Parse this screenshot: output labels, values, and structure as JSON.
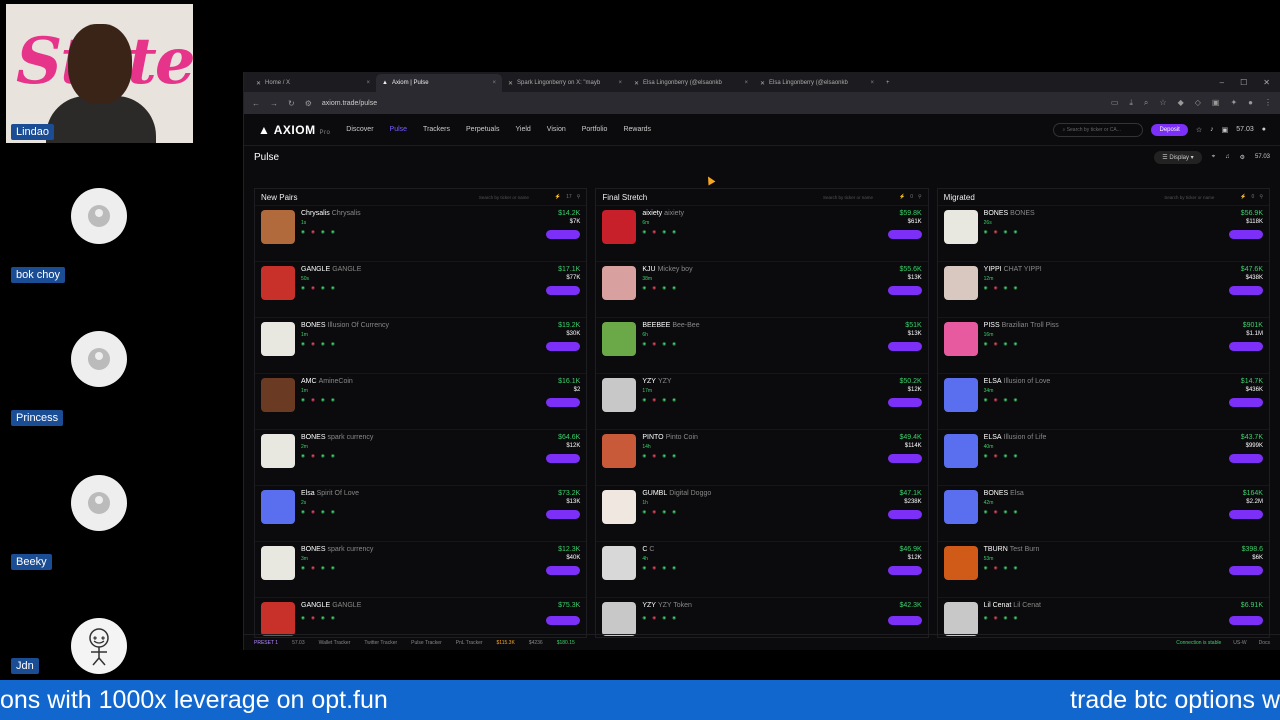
{
  "participants": [
    {
      "name": "Lindao",
      "type": "video"
    },
    {
      "name": "bok choy",
      "type": "avatar"
    },
    {
      "name": "Princess",
      "type": "avatar"
    },
    {
      "name": "Beeky",
      "type": "avatar"
    },
    {
      "name": "Jdn",
      "type": "drawn"
    }
  ],
  "cam_bg_text": "State",
  "browser": {
    "tabs": [
      {
        "label": "Home / X",
        "active": false
      },
      {
        "label": "Axiom | Pulse",
        "active": true
      },
      {
        "label": "Spark Lingonberry on X: \"mayb",
        "active": false
      },
      {
        "label": "Elsa Lingonberry (@elsaonkb",
        "active": false
      },
      {
        "label": "Elsa Lingonberry (@elsaonkb",
        "active": false
      }
    ],
    "url": "axiom.trade/pulse"
  },
  "nav": {
    "logo": "AXIOM",
    "logo_sub": "Pro",
    "items": [
      "Discover",
      "Pulse",
      "Trackers",
      "Perpetuals",
      "Yield",
      "Vision",
      "Portfolio",
      "Rewards"
    ],
    "active": "Pulse",
    "search_placeholder": "Search by ticker or CA...",
    "deposit": "Deposit",
    "balance": "57.03"
  },
  "page": {
    "title": "Pulse",
    "display_label": "Display",
    "balance": "57.03"
  },
  "columns": [
    {
      "title": "New Pairs",
      "search": "Search by ticker or name",
      "count": "17",
      "rows": [
        {
          "ticker": "Chrysalis",
          "name": "Chrysalis",
          "age": "1s",
          "mc": "$14.2K",
          "v": "$7K",
          "color": "#b06a3b"
        },
        {
          "ticker": "GANGLE",
          "name": "GANGLE",
          "age": "50s",
          "mc": "$17.1K",
          "v": "$77K",
          "color": "#c8302a"
        },
        {
          "ticker": "BONES",
          "name": "Illusion Of Currency",
          "age": "1m",
          "mc": "$19.2K",
          "v": "$30K",
          "color": "#e8e8e0"
        },
        {
          "ticker": "AMC",
          "name": "AmineCoin",
          "age": "1m",
          "mc": "$16.1K",
          "v": "$2",
          "color": "#6a3b22"
        },
        {
          "ticker": "BONES",
          "name": "spark currency",
          "age": "2m",
          "mc": "$64.6K",
          "v": "$12K",
          "color": "#e8e8e0"
        },
        {
          "ticker": "Elsa",
          "name": "Spirit Of Love",
          "age": "2s",
          "mc": "$73.2K",
          "v": "$13K",
          "color": "#5a6ff0"
        },
        {
          "ticker": "BONES",
          "name": "spark currency",
          "age": "3m",
          "mc": "$12.3K",
          "v": "$40K",
          "color": "#e8e8e0"
        },
        {
          "ticker": "GANGLE",
          "name": "GANGLE",
          "age": "",
          "mc": "$75.3K",
          "v": "",
          "color": "#c8302a"
        }
      ]
    },
    {
      "title": "Final Stretch",
      "search": "Search by ticker or name",
      "count": "0",
      "rows": [
        {
          "ticker": "aixiety",
          "name": "aixiety",
          "age": "6m",
          "mc": "$59.8K",
          "v": "$61K",
          "color": "#c8202a"
        },
        {
          "ticker": "KJU",
          "name": "Mickey boy",
          "age": "38m",
          "mc": "$55.6K",
          "v": "$13K",
          "color": "#d9a0a0"
        },
        {
          "ticker": "BEEBEE",
          "name": "Bee-Bee",
          "age": "6h",
          "mc": "$51K",
          "v": "$13K",
          "color": "#6aa848"
        },
        {
          "ticker": "YZY",
          "name": "YZY",
          "age": "17m",
          "mc": "$50.2K",
          "v": "$12K",
          "color": "#c8c8c8"
        },
        {
          "ticker": "PINTO",
          "name": "Pinto Coin",
          "age": "14h",
          "mc": "$49.4K",
          "v": "$114K",
          "color": "#c85a3a"
        },
        {
          "ticker": "GUMBL",
          "name": "Digital Doggo",
          "age": "1h",
          "mc": "$47.1K",
          "v": "$238K",
          "color": "#f0e8e0"
        },
        {
          "ticker": "C",
          "name": "C",
          "age": "4h",
          "mc": "$46.9K",
          "v": "$12K",
          "color": "#d8d8d8"
        },
        {
          "ticker": "YZY",
          "name": "YZY Token",
          "age": "",
          "mc": "$42.3K",
          "v": "",
          "color": "#c8c8c8"
        }
      ]
    },
    {
      "title": "Migrated",
      "search": "Search by ticker or name",
      "count": "0",
      "rows": [
        {
          "ticker": "BONES",
          "name": "BONES",
          "age": "26s",
          "mc": "$56.9K",
          "v": "$118K",
          "color": "#e8e8e0"
        },
        {
          "ticker": "YIPPI",
          "name": "CHAT YIPPI",
          "age": "12m",
          "mc": "$47.6K",
          "v": "$438K",
          "color": "#d8c8c0"
        },
        {
          "ticker": "PISS",
          "name": "Brazilian Troll Piss",
          "age": "16m",
          "mc": "$901K",
          "v": "$1.1M",
          "color": "#e85aa0"
        },
        {
          "ticker": "ELSA",
          "name": "Illusion of Love",
          "age": "34m",
          "mc": "$14.7K",
          "v": "$436K",
          "color": "#5a6ff0"
        },
        {
          "ticker": "ELSA",
          "name": "Illusion of Life",
          "age": "40m",
          "mc": "$43.7K",
          "v": "$999K",
          "color": "#5a6ff0"
        },
        {
          "ticker": "BONES",
          "name": "Elsa",
          "age": "42m",
          "mc": "$164K",
          "v": "$2.2M",
          "color": "#5a6ff0"
        },
        {
          "ticker": "TBURN",
          "name": "Test Burn",
          "age": "53m",
          "mc": "$398.6",
          "v": "$6K",
          "color": "#d05a18"
        },
        {
          "ticker": "Lil Cenat",
          "name": "Lil Cenat",
          "age": "",
          "mc": "$6.91K",
          "v": "",
          "color": "#c8c8c8"
        }
      ]
    }
  ],
  "statusbar": {
    "preset": "PRESET 1",
    "balance": "57.03",
    "wallet_tracker": "Wallet Tracker",
    "twitter_tracker": "Twitter Tracker",
    "pulse_tracker": "Pulse Tracker",
    "pnl_tracker": "PnL Tracker",
    "btc": "$115.3K",
    "eth": "$4236",
    "sol": "$180.15",
    "connection": "Connection is stable",
    "region": "US-W",
    "docs": "Docs"
  },
  "ticker": {
    "left": "ons with 1000x leverage on opt.fun",
    "right": "trade btc options w"
  }
}
